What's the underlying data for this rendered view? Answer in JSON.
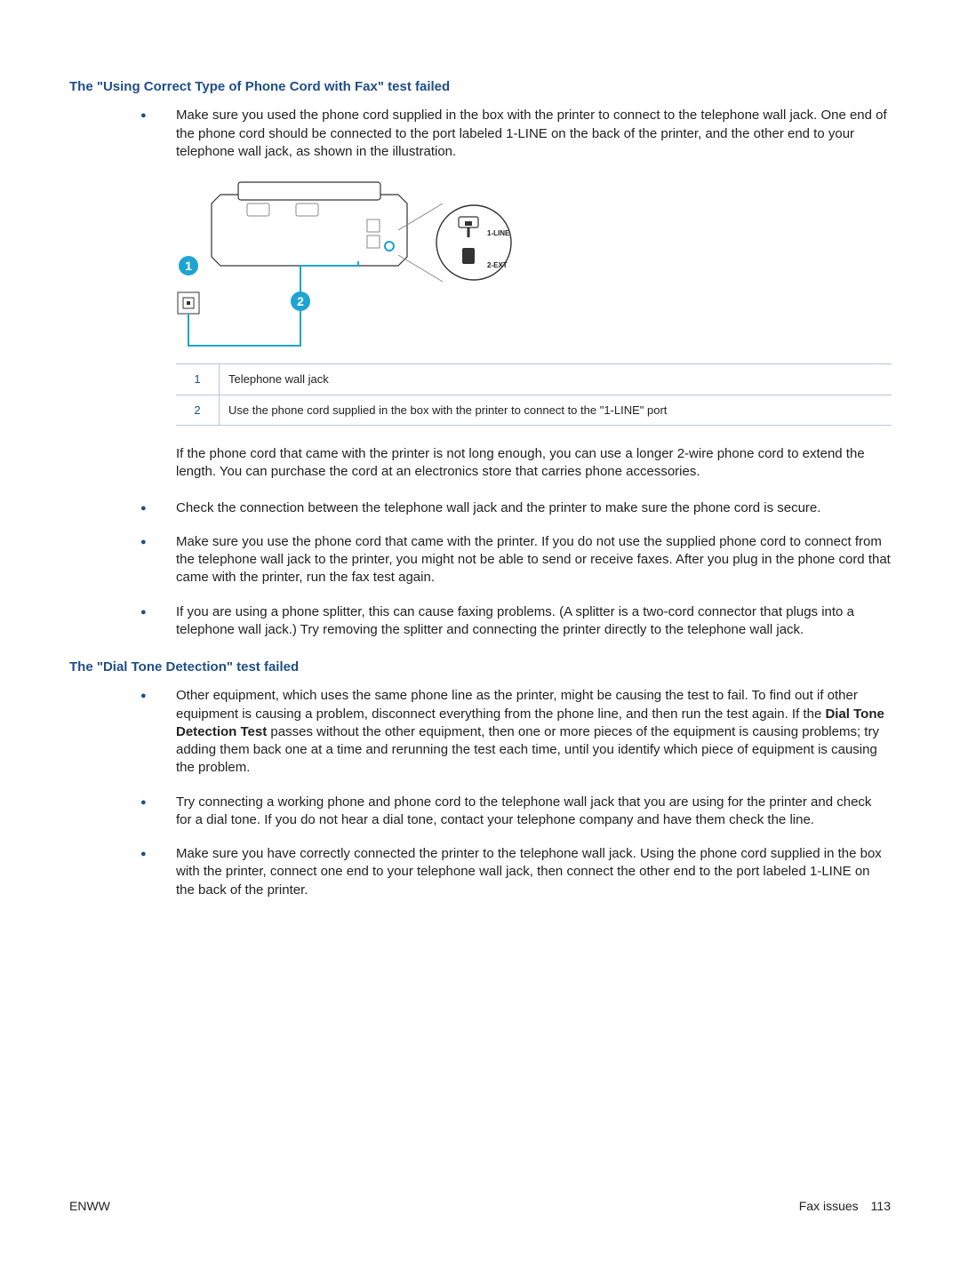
{
  "section1": {
    "heading": "The \"Using Correct Type of Phone Cord with Fax\" test failed",
    "bullets_a": [
      "Make sure you used the phone cord supplied in the box with the printer to connect to the telephone wall jack. One end of the phone cord should be connected to the port labeled 1-LINE on the back of the printer, and the other end to your telephone wall jack, as shown in the illustration."
    ],
    "illustration": {
      "label_line": "1-LINE",
      "label_ext": "2-EXT",
      "callout1": "1",
      "callout2": "2"
    },
    "legend": [
      {
        "num": "1",
        "text": "Telephone wall jack"
      },
      {
        "num": "2",
        "text": "Use the phone cord supplied in the box with the printer to connect to the \"1-LINE\" port"
      }
    ],
    "post_para": "If the phone cord that came with the printer is not long enough, you can use a longer 2-wire phone cord to extend the length. You can purchase the cord at an electronics store that carries phone accessories.",
    "bullets_b": [
      "Check the connection between the telephone wall jack and the printer to make sure the phone cord is secure.",
      "Make sure you use the phone cord that came with the printer. If you do not use the supplied phone cord to connect from the telephone wall jack to the printer, you might not be able to send or receive faxes. After you plug in the phone cord that came with the printer, run the fax test again.",
      "If you are using a phone splitter, this can cause faxing problems. (A splitter is a two-cord connector that plugs into a telephone wall jack.) Try removing the splitter and connecting the printer directly to the telephone wall jack."
    ]
  },
  "section2": {
    "heading": "The \"Dial Tone Detection\" test failed",
    "bullets": [
      {
        "pre": "Other equipment, which uses the same phone line as the printer, might be causing the test to fail. To find out if other equipment is causing a problem, disconnect everything from the phone line, and then run the test again. If the ",
        "strong": "Dial Tone Detection Test",
        "post": " passes without the other equipment, then one or more pieces of the equipment is causing problems; try adding them back one at a time and rerunning the test each time, until you identify which piece of equipment is causing the problem."
      },
      {
        "pre": "Try connecting a working phone and phone cord to the telephone wall jack that you are using for the printer and check for a dial tone. If you do not hear a dial tone, contact your telephone company and have them check the line.",
        "strong": "",
        "post": ""
      },
      {
        "pre": "Make sure you have correctly connected the printer to the telephone wall jack. Using the phone cord supplied in the box with the printer, connect one end to your telephone wall jack, then connect the other end to the port labeled 1-LINE on the back of the printer.",
        "strong": "",
        "post": ""
      }
    ]
  },
  "footer": {
    "left": "ENWW",
    "section": "Fax issues",
    "page": "113"
  }
}
